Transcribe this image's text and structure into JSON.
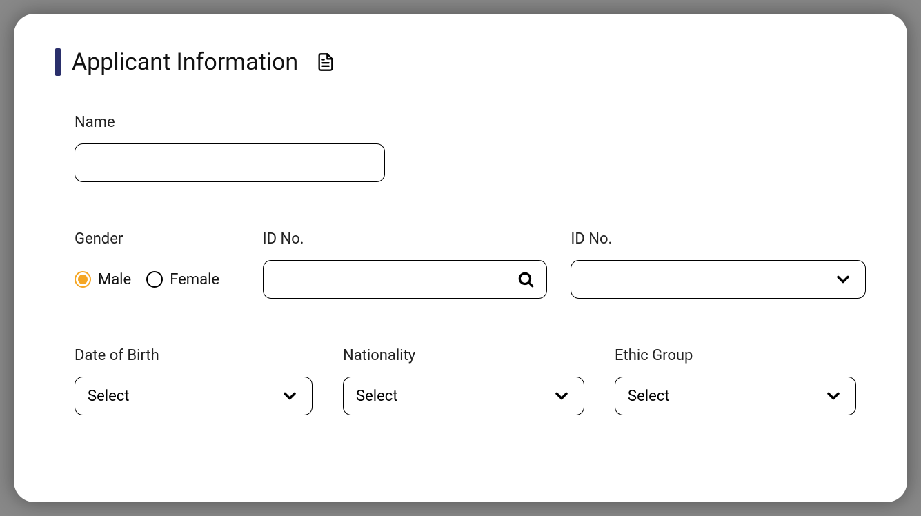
{
  "heading": {
    "title": "Applicant Information"
  },
  "fields": {
    "name": {
      "label": "Name",
      "value": ""
    },
    "gender": {
      "label": "Gender",
      "options": {
        "male": "Male",
        "female": "Female"
      },
      "selected": "male"
    },
    "id_input": {
      "label": "ID No.",
      "value": ""
    },
    "id_select": {
      "label": "ID No.",
      "value": ""
    },
    "dob": {
      "label": "Date of Birth",
      "value": "Select"
    },
    "nationality": {
      "label": "Nationality",
      "value": "Select"
    },
    "ethic_group": {
      "label": "Ethic Group",
      "value": "Select"
    }
  }
}
